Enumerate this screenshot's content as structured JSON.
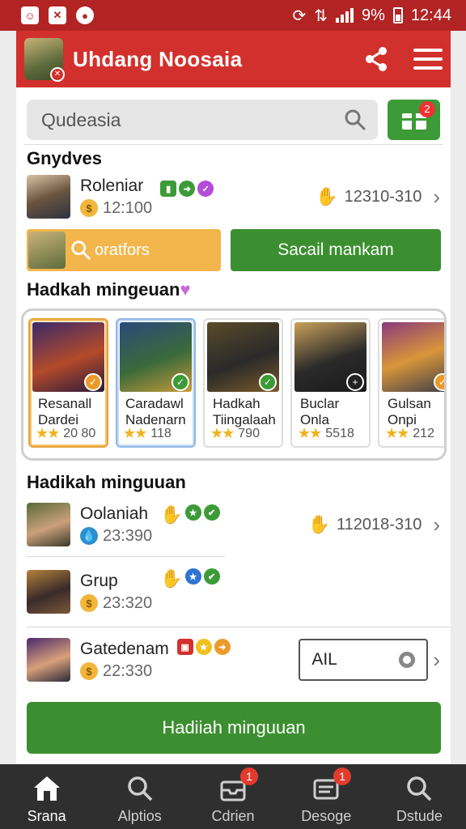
{
  "status_bar": {
    "time": "12:44",
    "battery": "9%"
  },
  "app": {
    "title": "Uhdang Noosaia"
  },
  "search": {
    "placeholder": "Qudeasia",
    "gift_badge": "2"
  },
  "section1": {
    "title": "Gnydves",
    "item": {
      "name": "Roleniar",
      "meta": "12:100",
      "value": "12310-310"
    }
  },
  "actions": {
    "search_label": "oratfors",
    "primary_label": "Sacail mankam"
  },
  "section2": {
    "title": "Hadkah mingeuan",
    "tiles": [
      {
        "line1": "Resanall",
        "line2": "Dardei",
        "score": "20 80"
      },
      {
        "line1": "Caradawl",
        "line2": "Nadenarn",
        "score": "118"
      },
      {
        "line1": "Hadkah",
        "line2": "Tiingalaah",
        "score": "790"
      },
      {
        "line1": "Buclar",
        "line2": "Onla",
        "score": "5518"
      },
      {
        "line1": "Gulsan",
        "line2": "Onpi",
        "score": "212"
      }
    ]
  },
  "section3": {
    "title": "Hadikah minguuan",
    "rows": [
      {
        "name": "Oolaniah",
        "meta": "23:390",
        "value": "112018-310"
      },
      {
        "name": "Grup",
        "meta": "23:320"
      },
      {
        "name": "Gatedenam",
        "meta": "22:330"
      }
    ],
    "filter_value": "AIL",
    "button_label": "Hadiiah minguuan"
  },
  "nav": {
    "items": [
      {
        "label": "Srana",
        "icon": "home-icon"
      },
      {
        "label": "Alptios",
        "icon": "search-icon"
      },
      {
        "label": "Cdrien",
        "icon": "inbox-icon",
        "badge": "1"
      },
      {
        "label": "Desoge",
        "icon": "message-icon",
        "badge": "1"
      },
      {
        "label": "Dstude",
        "icon": "search-icon"
      }
    ]
  }
}
